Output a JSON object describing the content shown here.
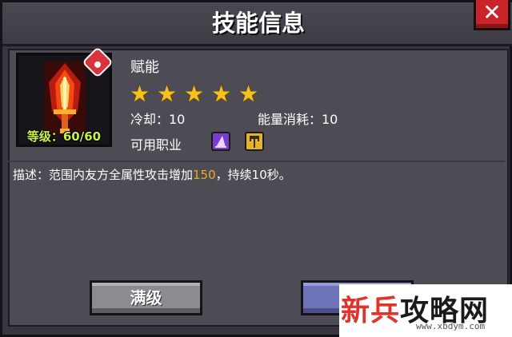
{
  "dialog": {
    "title": "技能信息",
    "close_icon": "close-icon"
  },
  "skill": {
    "icon": "flaming-sword-icon",
    "level_text": "等级：60/60",
    "name": "赋能",
    "stars": 5,
    "star_icon": "star-icon",
    "cooldown": "冷却：10",
    "energy_cost": "能量消耗：10",
    "jobs_label": "可用职业",
    "jobs": [
      {
        "icon": "mage-hat-icon",
        "color": "#7a3bd0"
      },
      {
        "icon": "priest-staff-icon",
        "color": "#e3b429"
      }
    ],
    "description": {
      "prefix": "描述：范围内友方全属性攻击增加",
      "value": "150",
      "suffix": "，持续10秒。"
    }
  },
  "buttons": {
    "max_label": "满级"
  },
  "watermark": {
    "main_red": "新兵",
    "main_black": "攻略网",
    "url": "www.xbdym.com"
  },
  "colors": {
    "highlight": "#f0a626",
    "level": "#c6f04a",
    "star": "#f7c21e",
    "close": "#c8242a"
  }
}
